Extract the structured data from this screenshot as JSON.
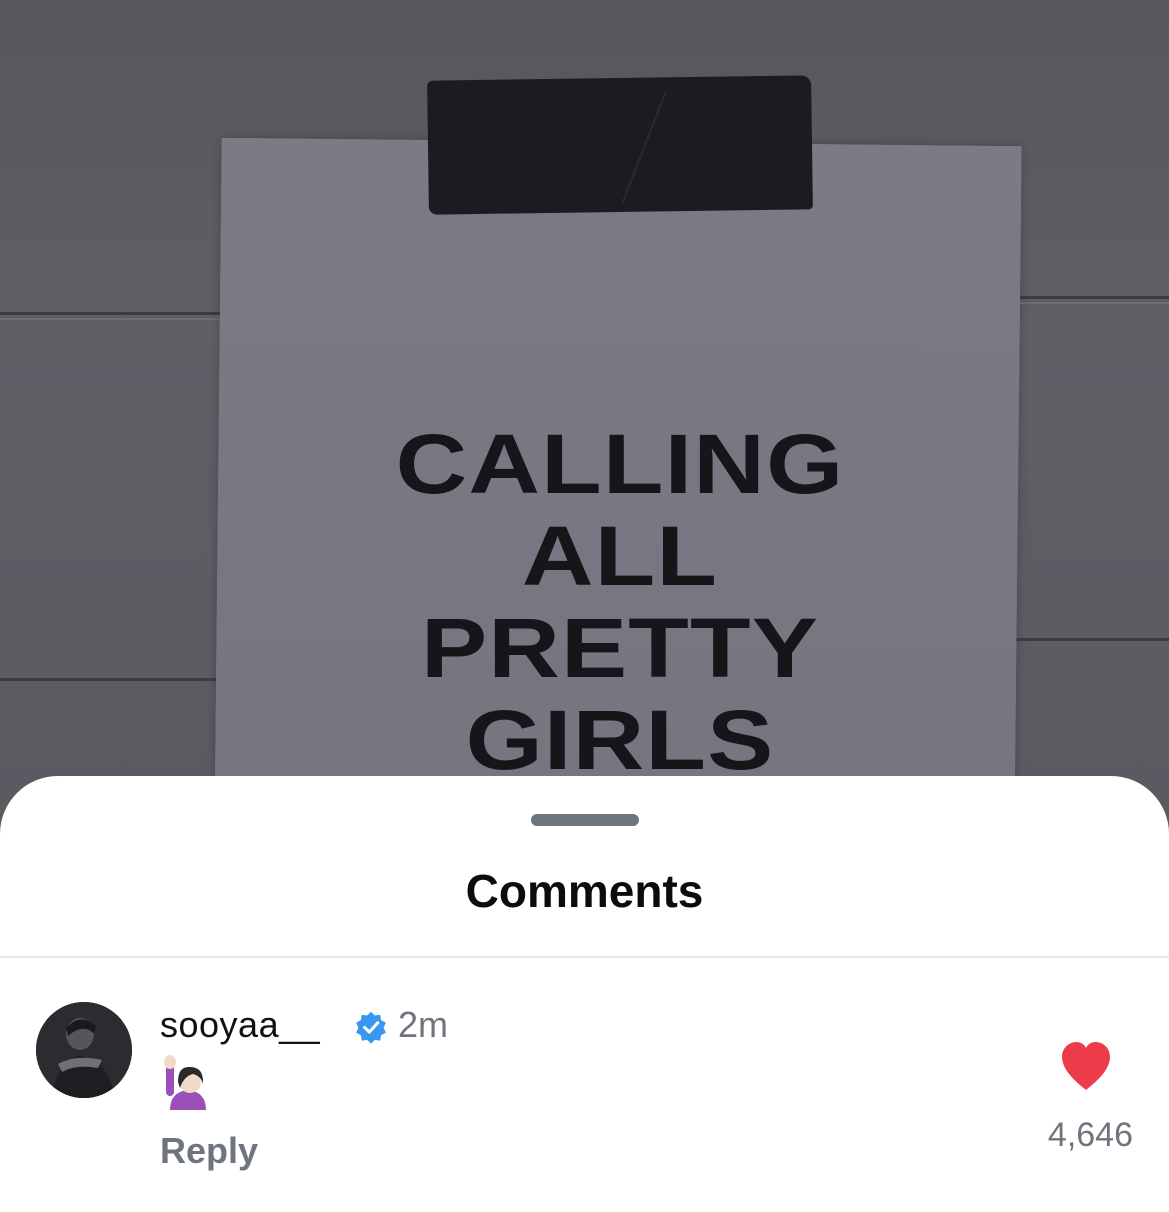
{
  "photo": {
    "sign_lines": [
      "CALLING",
      "ALL",
      "PRETTY",
      "GIRLS"
    ]
  },
  "sheet": {
    "title": "Comments"
  },
  "comment": {
    "username": "sooyaa__",
    "timestamp": "2m",
    "body_emoji": "🙋🏻‍♀️",
    "reply_label": "Reply",
    "like_count": "4,646"
  },
  "colors": {
    "heart": "#ED3B4A",
    "verified": "#3897F0",
    "secondary_text": "#6F757D"
  },
  "icons": {
    "verified": "verified-badge-icon",
    "like": "heart-icon",
    "grabber": "sheet-grabber"
  }
}
